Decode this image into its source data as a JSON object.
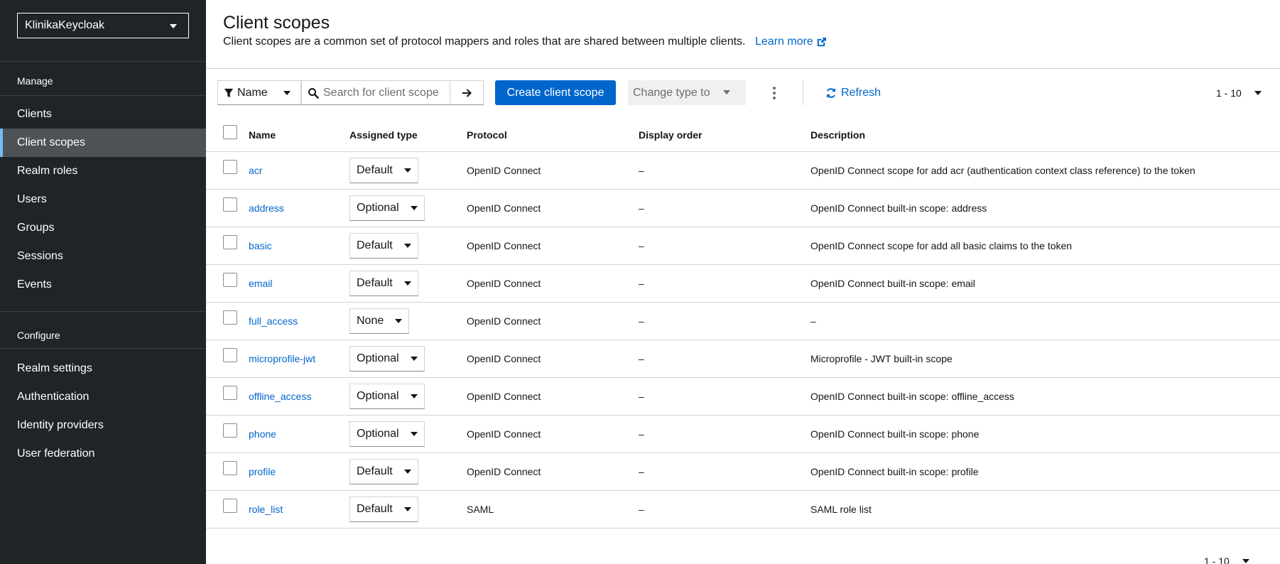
{
  "sidebar": {
    "realm": "KlinikaKeycloak",
    "sections": [
      {
        "label": "Manage"
      },
      {
        "label": "Configure"
      }
    ],
    "items": [
      {
        "label": "Clients"
      },
      {
        "label": "Client scopes"
      },
      {
        "label": "Realm roles"
      },
      {
        "label": "Users"
      },
      {
        "label": "Groups"
      },
      {
        "label": "Sessions"
      },
      {
        "label": "Events"
      },
      {
        "label": "Realm settings"
      },
      {
        "label": "Authentication"
      },
      {
        "label": "Identity providers"
      },
      {
        "label": "User federation"
      }
    ],
    "active_item": "Client scopes",
    "active_color": "#73bcf7"
  },
  "header": {
    "title": "Client scopes",
    "description": "Client scopes are a common set of protocol mappers and roles that are shared between multiple clients.",
    "learn_more": "Learn more"
  },
  "toolbar": {
    "filter_label": "Name",
    "search_placeholder": "Search for client scope",
    "create_label": "Create client scope",
    "change_type_label": "Change type to",
    "refresh_label": "Refresh",
    "pagination": "1 - 10"
  },
  "table": {
    "columns": [
      "Name",
      "Assigned type",
      "Protocol",
      "Display order",
      "Description"
    ],
    "rows": [
      {
        "name": "acr",
        "type": "Default",
        "protocol": "OpenID Connect",
        "order": "–",
        "description": "OpenID Connect scope for add acr (authentication context class reference) to the token"
      },
      {
        "name": "address",
        "type": "Optional",
        "protocol": "OpenID Connect",
        "order": "–",
        "description": "OpenID Connect built-in scope: address"
      },
      {
        "name": "basic",
        "type": "Default",
        "protocol": "OpenID Connect",
        "order": "–",
        "description": "OpenID Connect scope for add all basic claims to the token"
      },
      {
        "name": "email",
        "type": "Default",
        "protocol": "OpenID Connect",
        "order": "–",
        "description": "OpenID Connect built-in scope: email"
      },
      {
        "name": "full_access",
        "type": "None",
        "protocol": "OpenID Connect",
        "order": "–",
        "description": "–"
      },
      {
        "name": "microprofile-jwt",
        "type": "Optional",
        "protocol": "OpenID Connect",
        "order": "–",
        "description": "Microprofile - JWT built-in scope"
      },
      {
        "name": "offline_access",
        "type": "Optional",
        "protocol": "OpenID Connect",
        "order": "–",
        "description": "OpenID Connect built-in scope: offline_access"
      },
      {
        "name": "phone",
        "type": "Optional",
        "protocol": "OpenID Connect",
        "order": "–",
        "description": "OpenID Connect built-in scope: phone"
      },
      {
        "name": "profile",
        "type": "Default",
        "protocol": "OpenID Connect",
        "order": "–",
        "description": "OpenID Connect built-in scope: profile"
      },
      {
        "name": "role_list",
        "type": "Default",
        "protocol": "SAML",
        "order": "–",
        "description": "SAML role list"
      }
    ]
  },
  "footer": {
    "pagination": "1 - 10"
  },
  "colors": {
    "sidebar_bg": "#212427",
    "link": "#0066cc",
    "primary_button": "#0066cc"
  }
}
